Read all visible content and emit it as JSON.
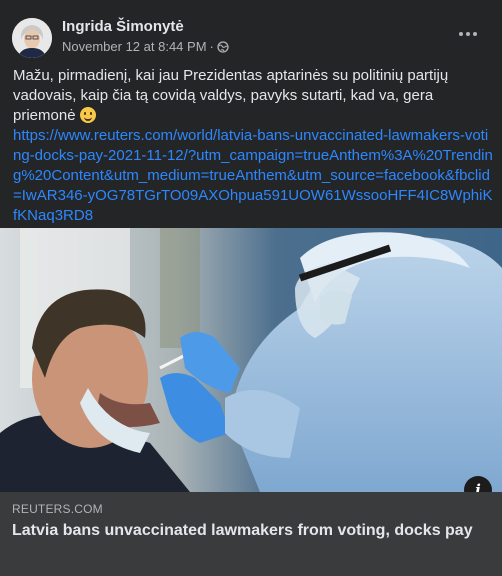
{
  "post": {
    "author": "Ingrida Šimonytė",
    "timestamp": "November 12 at 8:44 PM",
    "separator": "·",
    "audience_icon": "globe-icon",
    "more_icon": "more-options-icon",
    "text": "Mažu, pirmadienį, kai jau Prezidentas aptarinės su politinių partijų vadovais, kaip čia tą covidą valdys, pavyks sutarti, kad va, gera priemonė",
    "emoji": "slightly-smiling-face",
    "link": "https://www.reuters.com/world/latvia-bans-unvaccinated-lawmakers-voting-docks-pay-2021-11-12/?utm_campaign=trueAnthem%3A%20Trending%20Content&utm_medium=trueAnthem&utm_source=facebook&fbclid=IwAR346-yOG78TGrTO09AXOhpua591UOW61WssooHFF4IC8WphiKfKNaq3RD8"
  },
  "link_preview": {
    "image_icon": "info-icon",
    "info_label": "i",
    "source": "REUTERS.COM",
    "title": "Latvia bans unvaccinated lawmakers from voting, docks pay"
  },
  "colors": {
    "card": "#242526",
    "caption_bg": "#3a3b3c",
    "link": "#2d88ff",
    "primary_text": "#e4e6eb",
    "secondary_text": "#b0b3b8"
  }
}
